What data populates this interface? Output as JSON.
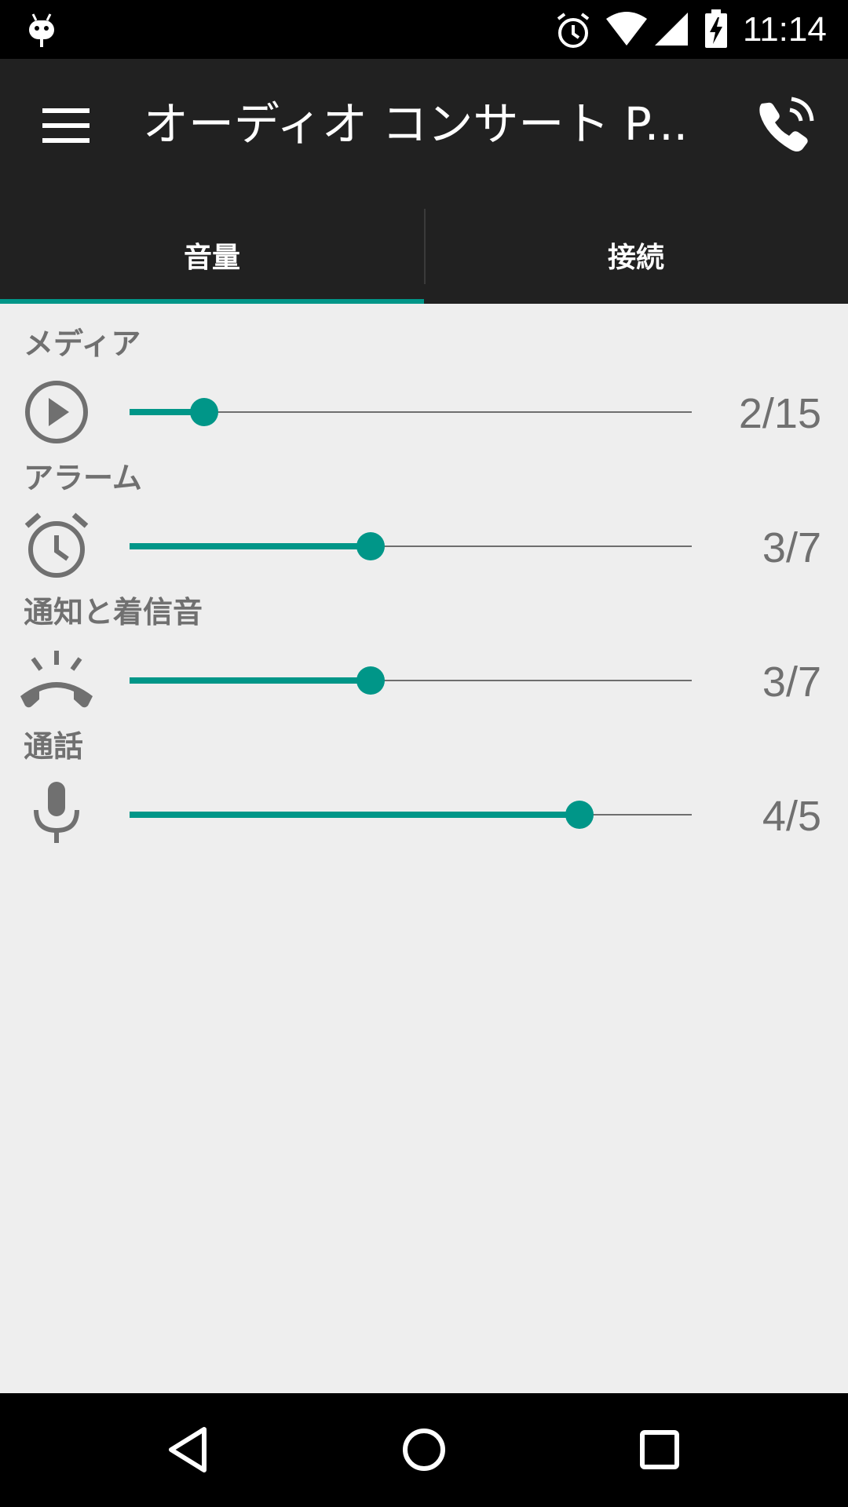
{
  "status_bar": {
    "time": "11:14",
    "icons": [
      "android-debug-icon",
      "alarm-icon",
      "wifi-icon",
      "signal-icon",
      "battery-charging-icon"
    ]
  },
  "app_bar": {
    "title": "オーディオ コンサート P...",
    "menu_icon": "hamburger-menu-icon",
    "action_icon": "ringing-phone-icon"
  },
  "tabs": [
    {
      "label": "音量",
      "selected": true
    },
    {
      "label": "接続",
      "selected": false
    }
  ],
  "volume_controls": [
    {
      "label": "メディア",
      "icon": "play-circle-icon",
      "current": 2,
      "max": 15,
      "value_text": "2/15"
    },
    {
      "label": "アラーム",
      "icon": "alarm-clock-icon",
      "current": 3,
      "max": 7,
      "value_text": "3/7"
    },
    {
      "label": "通知と着信音",
      "icon": "ringing-handset-icon",
      "current": 3,
      "max": 7,
      "value_text": "3/7"
    },
    {
      "label": "通話",
      "icon": "microphone-icon",
      "current": 4,
      "max": 5,
      "value_text": "4/5"
    }
  ],
  "nav_bar": {
    "buttons": [
      "back-icon",
      "home-icon",
      "recents-icon"
    ]
  },
  "colors": {
    "accent": "#009688",
    "app_bar": "#212121",
    "background": "#eeeeee",
    "label": "#707070"
  }
}
